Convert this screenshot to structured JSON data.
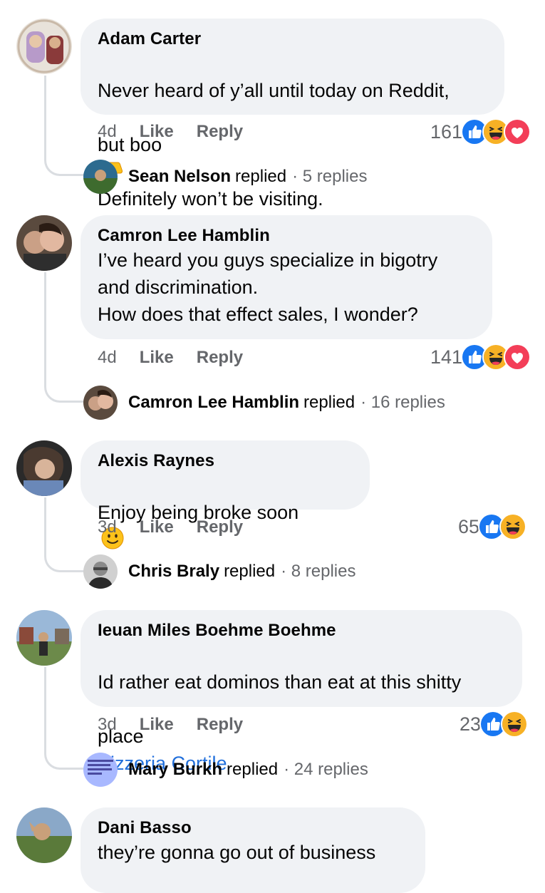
{
  "comments": [
    {
      "author": "Adam Carter",
      "text_line1": "Never heard of y’all until today on Reddit,",
      "text_line2a": "but boo",
      "text_line2_emoji": "thumbs-down-emoji",
      "text_line2b": "Definitely won’t be visiting.",
      "time": "4d",
      "like": "Like",
      "reply": "Reply",
      "reaction_count": "161",
      "reactions": [
        "like-reaction-icon",
        "haha-reaction-icon",
        "love-reaction-icon"
      ],
      "reply_author": "Sean Nelson",
      "reply_word": "replied",
      "reply_count": "· 5 replies"
    },
    {
      "author": "Camron Lee Hamblin",
      "text": "I’ve heard you guys specialize in bigotry\nand discrimination.\n  How does that effect sales, I wonder?",
      "time": "4d",
      "like": "Like",
      "reply": "Reply",
      "reaction_count": "141",
      "reactions": [
        "like-reaction-icon",
        "haha-reaction-icon",
        "love-reaction-icon"
      ],
      "reply_author": "Camron Lee Hamblin",
      "reply_word": "replied",
      "reply_count": "· 16 replies"
    },
    {
      "author": "Alexis Raynes",
      "text": "Enjoy being broke soon",
      "text_emoji": "slightly-smiling-emoji",
      "time": "3d",
      "like": "Like",
      "reply": "Reply",
      "reaction_count": "65",
      "reactions": [
        "like-reaction-icon",
        "haha-reaction-icon"
      ],
      "reply_author": "Chris Braly",
      "reply_word": "replied",
      "reply_count": "· 8 replies"
    },
    {
      "author": "Ieuan Miles Boehme Boehme",
      "text_line1": "Id rather eat dominos than eat at this shitty",
      "text_line2a": "place",
      "text_link": "Pizzeria Cortile",
      "time": "3d",
      "like": "Like",
      "reply": "Reply",
      "reaction_count": "23",
      "reactions": [
        "like-reaction-icon",
        "haha-reaction-icon"
      ],
      "reply_author": "Mary Burkh",
      "reply_word": "replied",
      "reply_count": "· 24 replies"
    },
    {
      "author": "Dani Basso",
      "text": "they’re gonna go out of business"
    }
  ],
  "colors": {
    "bubble": "#f0f2f5",
    "muted": "#65676b",
    "link": "#216fdb",
    "like_blue": "#1877f2",
    "love_red": "#f33e58",
    "haha_yellow": "#f7b125"
  }
}
